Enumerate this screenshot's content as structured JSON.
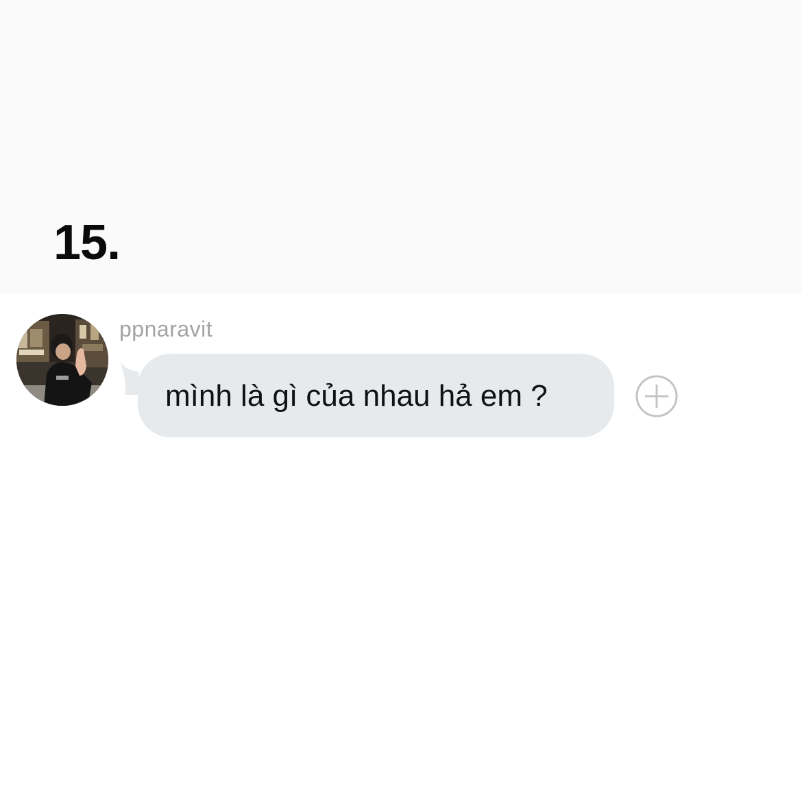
{
  "header": {
    "number_label": "15."
  },
  "message": {
    "sender": "ppnaravit",
    "text": "mình là gì của nhau hả em ?",
    "avatar": "profile-photo",
    "bubble_color": "#e7eaed",
    "add_icon": "plus-circle-icon"
  },
  "colors": {
    "background_top": "#fafafa",
    "background_chat": "#ffffff",
    "sender_text": "#a3a3a6",
    "message_text": "#111111",
    "icon_stroke": "#c4c4c6"
  }
}
